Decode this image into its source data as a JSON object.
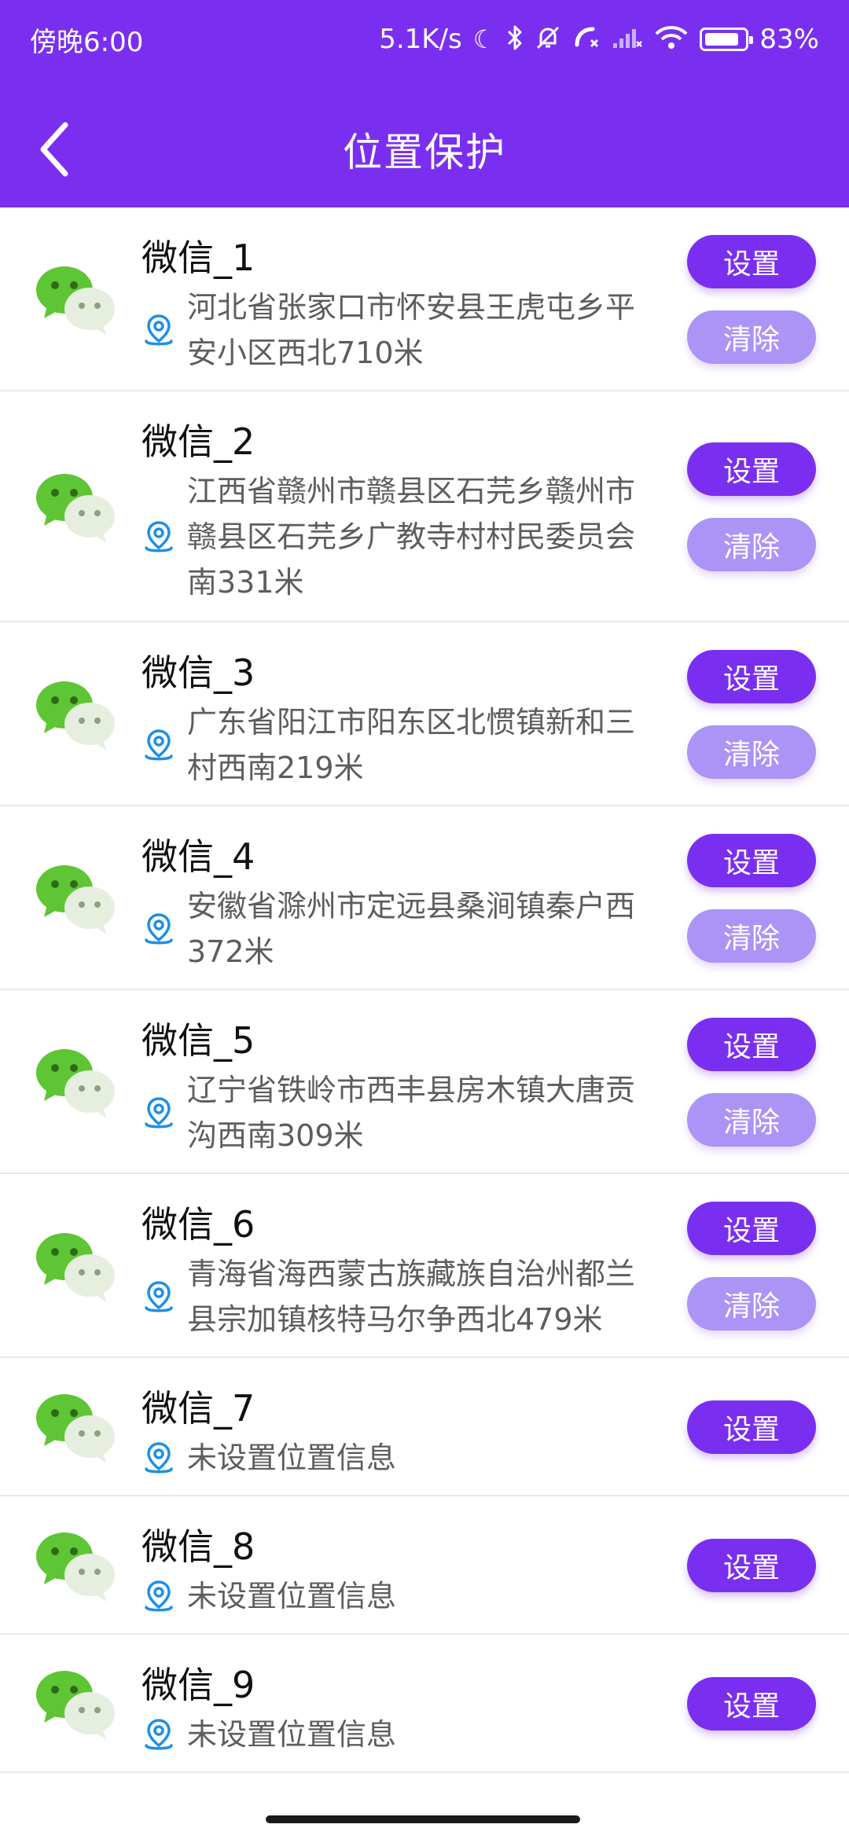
{
  "status_bar": {
    "time": "傍晚6:00",
    "net_speed": "5.1K/s",
    "battery": "83%",
    "battery_level": 0.83
  },
  "header": {
    "title": "位置保护"
  },
  "colors": {
    "accent": "#7a2ff0",
    "accent_light": "#ab94f5",
    "location": "#1e8fe6",
    "wechat_green": "#5ec534"
  },
  "items": [
    {
      "name": "微信_1",
      "address": "河北省张家口市怀安县王虎屯乡平安小区西北710米",
      "set_label": "设置",
      "clear_label": "清除"
    },
    {
      "name": "微信_2",
      "address": "江西省赣州市赣县区石芫乡赣州市赣县区石芫乡广教寺村村民委员会南331米",
      "set_label": "设置",
      "clear_label": "清除"
    },
    {
      "name": "微信_3",
      "address": "广东省阳江市阳东区北惯镇新和三村西南219米",
      "set_label": "设置",
      "clear_label": "清除"
    },
    {
      "name": "微信_4",
      "address": "安徽省滁州市定远县桑涧镇秦户西372米",
      "set_label": "设置",
      "clear_label": "清除"
    },
    {
      "name": "微信_5",
      "address": "辽宁省铁岭市西丰县房木镇大唐贡沟西南309米",
      "set_label": "设置",
      "clear_label": "清除"
    },
    {
      "name": "微信_6",
      "address": "青海省海西蒙古族藏族自治州都兰县宗加镇核特马尔争西北479米",
      "set_label": "设置",
      "clear_label": "清除"
    },
    {
      "name": "微信_7",
      "address": "未设置位置信息",
      "set_label": "设置"
    },
    {
      "name": "微信_8",
      "address": "未设置位置信息",
      "set_label": "设置"
    },
    {
      "name": "微信_9",
      "address": "未设置位置信息",
      "set_label": "设置"
    }
  ]
}
